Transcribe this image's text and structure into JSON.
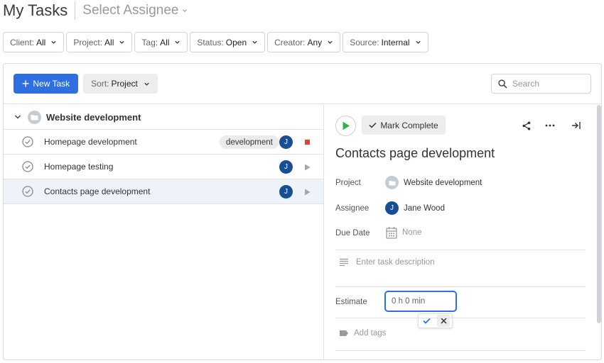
{
  "header": {
    "title": "My Tasks",
    "assignee_placeholder": "Select Assignee"
  },
  "filters": [
    {
      "label": "Client:",
      "value": "All"
    },
    {
      "label": "Project:",
      "value": "All"
    },
    {
      "label": "Tag:",
      "value": "All"
    },
    {
      "label": "Status:",
      "value": "Open"
    },
    {
      "label": "Creator:",
      "value": "Any"
    },
    {
      "label": "Source:",
      "value": "Internal"
    }
  ],
  "toolbar": {
    "new_task_label": "New Task",
    "sort_label": "Sort:",
    "sort_value": "Project",
    "search_placeholder": "Search"
  },
  "list": {
    "group_title": "Website development",
    "tasks": [
      {
        "name": "Homepage development",
        "tag": "development",
        "assignee_initial": "J",
        "action": "stop"
      },
      {
        "name": "Homepage testing",
        "assignee_initial": "J",
        "action": "play"
      },
      {
        "name": "Contacts page development",
        "assignee_initial": "J",
        "action": "play",
        "selected": true
      }
    ]
  },
  "detail": {
    "mark_complete_label": "Mark Complete",
    "title": "Contacts page development",
    "project_label": "Project",
    "project_value": "Website development",
    "assignee_label": "Assignee",
    "assignee_initial": "J",
    "assignee_value": "Jane Wood",
    "due_label": "Due Date",
    "due_value": "None",
    "description_placeholder": "Enter task description",
    "estimate_label": "Estimate",
    "estimate_value": "0 h 0 min",
    "tags_placeholder": "Add tags"
  },
  "colors": {
    "accent": "#2f6fe0",
    "avatar": "#184e95",
    "stop": "#ef3b30",
    "play_green": "#2cb34a"
  }
}
